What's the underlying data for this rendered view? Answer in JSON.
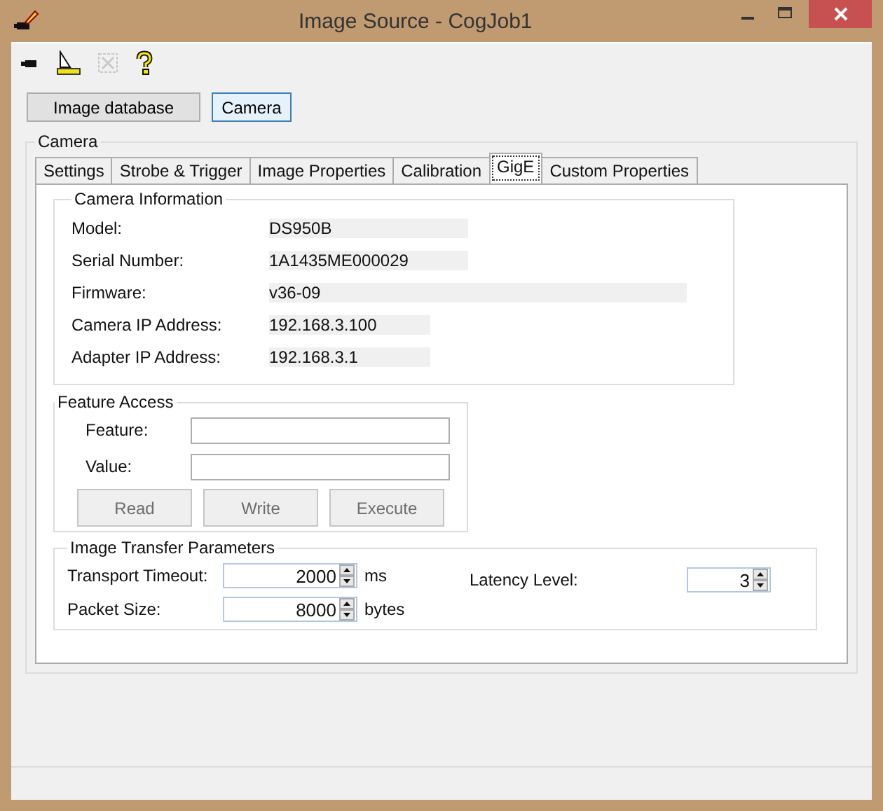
{
  "window": {
    "title": "Image Source - CogJob1"
  },
  "toolbar": [
    {
      "kind": "camera",
      "disabled": false
    },
    {
      "kind": "ruler",
      "disabled": false
    },
    {
      "kind": "crop",
      "disabled": true
    },
    {
      "kind": "help",
      "disabled": false
    }
  ],
  "mode_buttons": [
    {
      "label": "Image database",
      "selected": false
    },
    {
      "label": "Camera",
      "selected": true
    }
  ],
  "camera_group": {
    "title": "Camera",
    "tabs": [
      {
        "label": "Settings",
        "selected": false
      },
      {
        "label": "Strobe & Trigger",
        "selected": false
      },
      {
        "label": "Image Properties",
        "selected": false
      },
      {
        "label": "Calibration",
        "selected": false
      },
      {
        "label": "GigE",
        "selected": true
      },
      {
        "label": "Custom Properties",
        "selected": false
      }
    ],
    "camera_information": {
      "title": "Camera Information",
      "rows": [
        {
          "label": "Model:",
          "value": "DS950B"
        },
        {
          "label": "Serial Number:",
          "value": "1A1435ME000029"
        },
        {
          "label": "Firmware:",
          "value": "v36-09"
        },
        {
          "label": "Camera IP Address:",
          "value": "192.168.3.100"
        },
        {
          "label": "Adapter IP Address:",
          "value": "192.168.3.1"
        }
      ]
    },
    "feature_access": {
      "title": "Feature Access",
      "fields": [
        {
          "label": "Feature:"
        },
        {
          "label": "Value:"
        }
      ],
      "buttons": [
        {
          "label": "Read",
          "disabled": true
        },
        {
          "label": "Write",
          "disabled": true
        },
        {
          "label": "Execute",
          "disabled": true
        }
      ]
    },
    "image_transfer": {
      "title": "Image Transfer Parameters",
      "transport_timeout": {
        "label": "Transport Timeout:",
        "value": "2000",
        "unit": "ms"
      },
      "packet_size": {
        "label": "Packet Size:",
        "value": "8000",
        "unit": "bytes"
      },
      "latency_level": {
        "label": "Latency Level:",
        "value": "3"
      }
    }
  }
}
